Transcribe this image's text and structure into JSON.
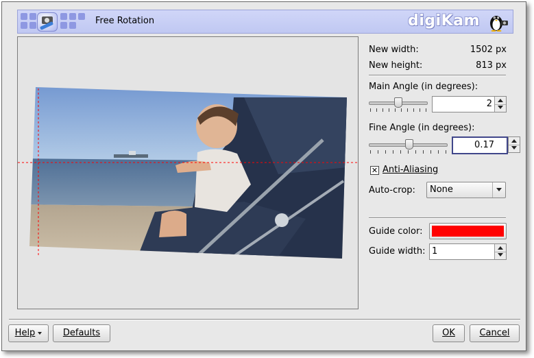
{
  "header": {
    "title": "Free Rotation",
    "brand": "digiKam"
  },
  "info": {
    "new_width_label": "New width:",
    "new_width_value": "1502 px",
    "new_height_label": "New height:",
    "new_height_value": "813 px"
  },
  "main_angle": {
    "label": "Main Angle (in degrees):",
    "value": "2"
  },
  "fine_angle": {
    "label": "Fine Angle (in degrees):",
    "value": "0.17"
  },
  "anti_aliasing": {
    "label": "Anti-Aliasing",
    "checked": true
  },
  "auto_crop": {
    "label": "Auto-crop:",
    "value": "None"
  },
  "guide": {
    "color_label": "Guide color:",
    "color_value": "#ff0000",
    "width_label": "Guide width:",
    "width_value": "1"
  },
  "buttons": {
    "help": "Help",
    "defaults": "Defaults",
    "ok": "OK",
    "cancel": "Cancel"
  },
  "colors": {
    "header_bg": "#c6cdf4",
    "guide_line": "#ff0000"
  }
}
